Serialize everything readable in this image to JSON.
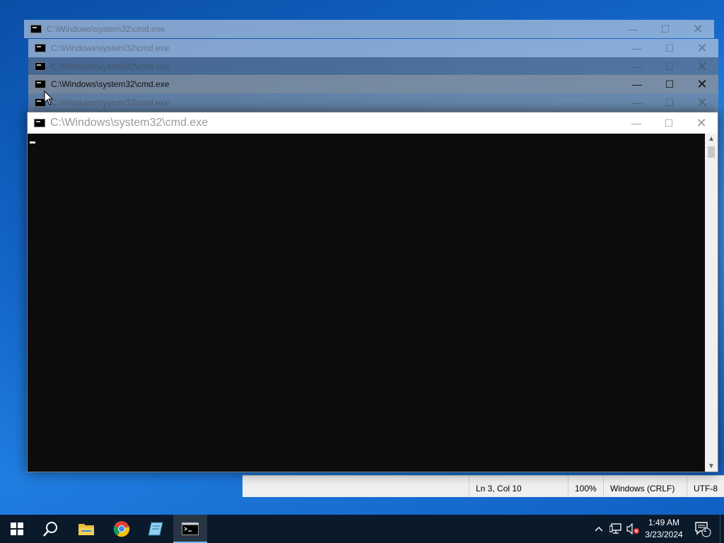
{
  "desktop": {
    "background_color": "#1466c8"
  },
  "windows": {
    "cmd_title": "C:\\Windows\\system32\\cmd.exe",
    "minimize_glyph": "—",
    "maximize_glyph": "☐",
    "close_glyph": "✕"
  },
  "notepad": {
    "status_position": "Ln 3, Col 10",
    "status_zoom": "100%",
    "status_line_ending": "Windows (CRLF)",
    "status_encoding": "UTF-8"
  },
  "console": {
    "scroll_up": "▲",
    "scroll_down": "▼"
  },
  "taskbar": {
    "items": [
      {
        "name": "start-button",
        "icon": "windows-logo-icon"
      },
      {
        "name": "search-button",
        "icon": "search-icon"
      },
      {
        "name": "file-explorer-button",
        "icon": "folder-icon"
      },
      {
        "name": "chrome-button",
        "icon": "chrome-icon"
      },
      {
        "name": "app-button",
        "icon": "app-icon"
      },
      {
        "name": "cmd-taskbar-button",
        "icon": "cmd-icon",
        "active": true
      }
    ],
    "time": "1:49 AM",
    "date": "3/23/2024",
    "notification_count": "1"
  }
}
